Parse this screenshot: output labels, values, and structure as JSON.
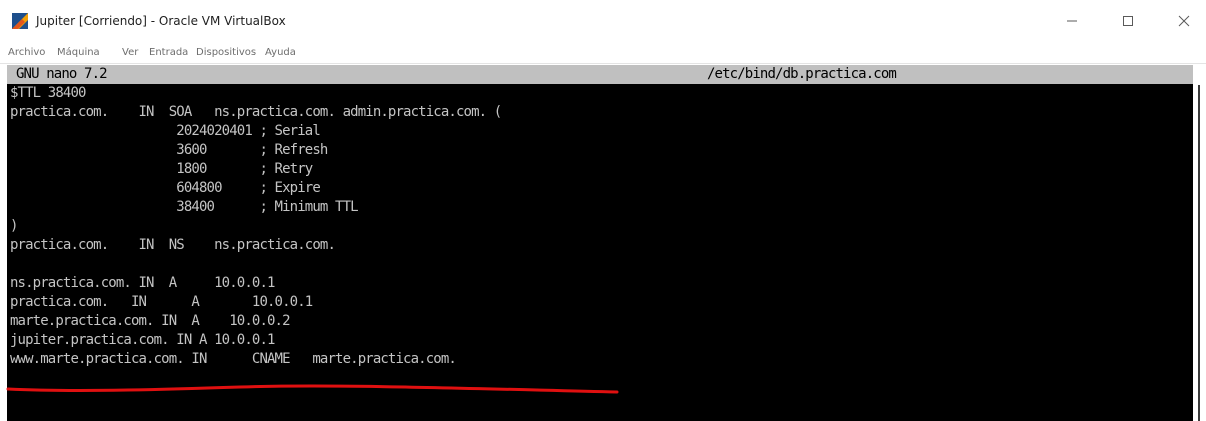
{
  "window": {
    "title": "Jupiter [Corriendo] - Oracle VM VirtualBox",
    "icon": "virtualbox-icon"
  },
  "menu": [
    "Archivo",
    "Máquina",
    "Ver",
    "Entrada",
    "Dispositivos",
    "Ayuda"
  ],
  "nano": {
    "version_label": "GNU nano 7.2",
    "file_path": "/etc/bind/db.practica.com"
  },
  "file_lines": [
    "$TTL 38400",
    "practica.com.    IN  SOA   ns.practica.com. admin.practica.com. (",
    "                      2024020401 ; Serial",
    "                      3600       ; Refresh",
    "                      1800       ; Retry",
    "                      604800     ; Expire",
    "                      38400      ; Minimum TTL",
    ")",
    "practica.com.    IN  NS    ns.practica.com.",
    "",
    "ns.practica.com. IN  A     10.0.0.1",
    "practica.com.   IN      A       10.0.0.1",
    "marte.practica.com. IN  A    10.0.0.2",
    "jupiter.practica.com. IN A 10.0.0.1",
    "www.marte.practica.com. IN      CNAME   marte.practica.com."
  ],
  "colors": {
    "terminal_bg": "#000000",
    "terminal_fg": "#c4c4c4",
    "header_bg": "#c0c0c0",
    "annotation": "#e01010"
  }
}
